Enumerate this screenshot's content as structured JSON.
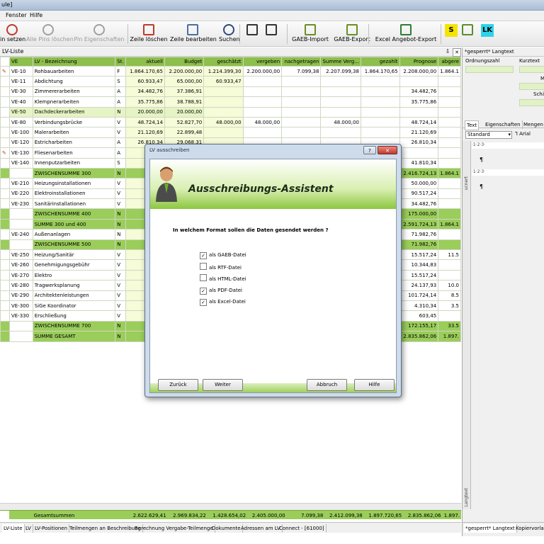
{
  "window": {
    "title_fragment": "ule]"
  },
  "menu": [
    "Fenster",
    "Hilfe"
  ],
  "toolbar": [
    {
      "label": "in setzen",
      "disabled": false,
      "icon": "pin-icon"
    },
    {
      "label": "Alle Pins löschen",
      "disabled": true,
      "icon": "pin-icon"
    },
    {
      "label": "Pin Eigenschaften",
      "disabled": true,
      "icon": "pin-icon"
    },
    {
      "label": "Zeile löschen",
      "disabled": false,
      "icon": "delete-row-icon"
    },
    {
      "label": "Zeile bearbeiten",
      "disabled": false,
      "icon": "edit-row-icon"
    },
    {
      "label": "Suchen",
      "disabled": false,
      "icon": "binoculars-icon"
    },
    {
      "label": "",
      "disabled": false,
      "icon": "indent-icon"
    },
    {
      "label": "",
      "disabled": false,
      "icon": "outdent-icon"
    },
    {
      "label": "GAEB-Import",
      "disabled": false,
      "icon": "gaeb-import-icon"
    },
    {
      "label": "GAEB-Export",
      "disabled": false,
      "icon": "gaeb-export-icon"
    },
    {
      "label": "Excel Angebot-Export",
      "disabled": false,
      "icon": "excel-export-icon"
    },
    {
      "label": "S",
      "disabled": false,
      "icon": "s-icon"
    },
    {
      "label": "",
      "disabled": false,
      "icon": "image-icon"
    },
    {
      "label": "LK",
      "disabled": false,
      "icon": "lk-icon"
    }
  ],
  "lv_panel": {
    "title": "LV-Liste",
    "pin_glyph": "⇩",
    "close_glyph": "✕"
  },
  "columns": [
    "VE",
    "LV - Bezeichnung",
    "St.",
    "aktuell",
    "Budget",
    "geschätzt",
    "vergeben",
    "nachgetragen",
    "Summe Verg...",
    "gezahlt",
    "Prognose",
    "abgere"
  ],
  "rows": [
    {
      "ve": "VE-10",
      "bez": "Rohbauarbeiten",
      "st": "F",
      "aktuell": "1.864.170,65",
      "budget": "2.200.000,00",
      "geschaetzt": "1.214.399,30",
      "vergeben": "2.200.000,00",
      "nach": "7.099,38",
      "summe": "2.207.099,38",
      "gezahlt": "1.864.170,65",
      "prognose": "2.208.000,00",
      "abg": "1.864.1",
      "flag": true
    },
    {
      "ve": "VE-11",
      "bez": "Abdichtung",
      "st": "S",
      "aktuell": "60.933,47",
      "budget": "65.000,00",
      "geschaetzt": "60.933,47",
      "vergeben": "",
      "nach": "",
      "summe": "",
      "gezahlt": "",
      "prognose": "",
      "abg": ""
    },
    {
      "ve": "VE-30",
      "bez": "Zimmererarbeiten",
      "st": "A",
      "aktuell": "34.482,76",
      "budget": "37.386,91",
      "geschaetzt": "",
      "vergeben": "",
      "nach": "",
      "summe": "",
      "gezahlt": "",
      "prognose": "34.482,76",
      "abg": ""
    },
    {
      "ve": "VE-40",
      "bez": "Klempnerarbeiten",
      "st": "A",
      "aktuell": "35.775,86",
      "budget": "38.788,91",
      "geschaetzt": "",
      "vergeben": "",
      "nach": "",
      "summe": "",
      "gezahlt": "",
      "prognose": "35.775,86",
      "abg": ""
    },
    {
      "ve": "VE-50",
      "bez": "Dachdeckerarbeiten",
      "st": "N",
      "aktuell": "20.000,00",
      "budget": "20.000,00",
      "geschaetzt": "",
      "vergeben": "",
      "nach": "",
      "summe": "",
      "gezahlt": "",
      "prognose": "",
      "abg": "",
      "lite": true
    },
    {
      "ve": "VE-80",
      "bez": "Verbindungsbrücke",
      "st": "V",
      "aktuell": "48.724,14",
      "budget": "52.827,70",
      "geschaetzt": "48.000,00",
      "vergeben": "48.000,00",
      "nach": "",
      "summe": "48.000,00",
      "gezahlt": "",
      "prognose": "48.724,14",
      "abg": ""
    },
    {
      "ve": "VE-100",
      "bez": "Malerarbeiten",
      "st": "V",
      "aktuell": "21.120,69",
      "budget": "22.899,48",
      "geschaetzt": "",
      "vergeben": "",
      "nach": "",
      "summe": "",
      "gezahlt": "",
      "prognose": "21.120,69",
      "abg": ""
    },
    {
      "ve": "VE-120",
      "bez": "Estricharbeiten",
      "st": "A",
      "aktuell": "26.810,34",
      "budget": "29.068,31",
      "geschaetzt": "",
      "vergeben": "",
      "nach": "",
      "summe": "",
      "gezahlt": "",
      "prognose": "26.810,34",
      "abg": ""
    },
    {
      "ve": "VE-130",
      "bez": "Fliesenarbeiten",
      "st": "A",
      "aktuell": "",
      "budget": "",
      "geschaetzt": "",
      "vergeben": "",
      "nach": "",
      "summe": "",
      "gezahlt": "",
      "prognose": "",
      "abg": "",
      "flag": true
    },
    {
      "ve": "VE-140",
      "bez": "Innenputzarbeiten",
      "st": "S",
      "aktuell": "",
      "budget": "",
      "geschaetzt": "",
      "vergeben": "",
      "nach": "",
      "summe": "",
      "gezahlt": "",
      "prognose": "41.810,34",
      "abg": ""
    },
    {
      "ve": "",
      "bez": "ZWISCHENSUMME 300",
      "st": "N",
      "aktuell": "",
      "budget": "",
      "geschaetzt": "",
      "vergeben": "",
      "nach": "",
      "summe": "",
      "gezahlt": "",
      "prognose": "2.416.724,13",
      "abg": "1.864.1",
      "sub": true
    },
    {
      "ve": "VE-210",
      "bez": "Heizungsinstallationen",
      "st": "V",
      "aktuell": "",
      "budget": "",
      "geschaetzt": "",
      "vergeben": "",
      "nach": "",
      "summe": "",
      "gezahlt": "",
      "prognose": "50.000,00",
      "abg": ""
    },
    {
      "ve": "VE-220",
      "bez": "Elektroinstallationen",
      "st": "V",
      "aktuell": "",
      "budget": "",
      "geschaetzt": "",
      "vergeben": "",
      "nach": "",
      "summe": "",
      "gezahlt": "",
      "prognose": "90.517,24",
      "abg": ""
    },
    {
      "ve": "VE-230",
      "bez": "Sanitärinstallationen",
      "st": "V",
      "aktuell": "",
      "budget": "",
      "geschaetzt": "",
      "vergeben": "",
      "nach": "",
      "summe": "",
      "gezahlt": "",
      "prognose": "34.482,76",
      "abg": ""
    },
    {
      "ve": "",
      "bez": "ZWISCHENSUMME 400",
      "st": "N",
      "aktuell": "",
      "budget": "",
      "geschaetzt": "",
      "vergeben": "",
      "nach": "",
      "summe": "",
      "gezahlt": "",
      "prognose": "175.000,00",
      "abg": "",
      "sub": true
    },
    {
      "ve": "",
      "bez": "SUMME 300 und 400",
      "st": "N",
      "aktuell": "",
      "budget": "",
      "geschaetzt": "",
      "vergeben": "",
      "nach": "",
      "summe": "",
      "gezahlt": "",
      "prognose": "2.591.724,13",
      "abg": "1.864.1",
      "sub": true
    },
    {
      "ve": "VE-240",
      "bez": "Außenanlagen",
      "st": "N",
      "aktuell": "",
      "budget": "",
      "geschaetzt": "",
      "vergeben": "",
      "nach": "",
      "summe": "",
      "gezahlt": "",
      "prognose": "71.982,76",
      "abg": ""
    },
    {
      "ve": "",
      "bez": "ZWISCHENSUMME 500",
      "st": "N",
      "aktuell": "",
      "budget": "",
      "geschaetzt": "",
      "vergeben": "",
      "nach": "",
      "summe": "",
      "gezahlt": "",
      "prognose": "71.982,76",
      "abg": "",
      "sub": true
    },
    {
      "ve": "VE-250",
      "bez": "Heizung/Sanitär",
      "st": "V",
      "aktuell": "",
      "budget": "",
      "geschaetzt": "",
      "vergeben": "",
      "nach": "",
      "summe": "",
      "gezahlt": "",
      "prognose": "15.517,24",
      "abg": "11.5"
    },
    {
      "ve": "VE-260",
      "bez": "Genehmigungsgebühr",
      "st": "V",
      "aktuell": "",
      "budget": "",
      "geschaetzt": "",
      "vergeben": "",
      "nach": "",
      "summe": "",
      "gezahlt": "",
      "prognose": "10.344,83",
      "abg": ""
    },
    {
      "ve": "VE-270",
      "bez": "Elektro",
      "st": "V",
      "aktuell": "",
      "budget": "",
      "geschaetzt": "",
      "vergeben": "",
      "nach": "",
      "summe": "",
      "gezahlt": "",
      "prognose": "15.517,24",
      "abg": ""
    },
    {
      "ve": "VE-280",
      "bez": "Tragwerksplanung",
      "st": "V",
      "aktuell": "",
      "budget": "",
      "geschaetzt": "",
      "vergeben": "",
      "nach": "",
      "summe": "",
      "gezahlt": "",
      "prognose": "24.137,93",
      "abg": "10.0"
    },
    {
      "ve": "VE-290",
      "bez": "Architektenleistungen",
      "st": "V",
      "aktuell": "",
      "budget": "",
      "geschaetzt": "",
      "vergeben": "",
      "nach": "",
      "summe": "",
      "gezahlt": "",
      "prognose": "101.724,14",
      "abg": "8.5"
    },
    {
      "ve": "VE-300",
      "bez": "SiGe Koordinator",
      "st": "V",
      "aktuell": "",
      "budget": "",
      "geschaetzt": "",
      "vergeben": "",
      "nach": "",
      "summe": "",
      "gezahlt": "",
      "prognose": "4.310,34",
      "abg": "3.5"
    },
    {
      "ve": "VE-330",
      "bez": "Erschließung",
      "st": "V",
      "aktuell": "",
      "budget": "",
      "geschaetzt": "",
      "vergeben": "",
      "nach": "",
      "summe": "",
      "gezahlt": "",
      "prognose": "603,45",
      "abg": ""
    },
    {
      "ve": "",
      "bez": "ZWISCHENSUMME 700",
      "st": "N",
      "aktuell": "",
      "budget": "",
      "geschaetzt": "",
      "vergeben": "",
      "nach": "",
      "summe": "",
      "gezahlt": "",
      "prognose": "172.155,17",
      "abg": "33.5",
      "sub": true
    },
    {
      "ve": "",
      "bez": "SUMME GESAMT",
      "st": "N",
      "aktuell": "",
      "budget": "",
      "geschaetzt": "",
      "vergeben": "",
      "nach": "",
      "summe": "",
      "gezahlt": "",
      "prognose": "2.835.862,06",
      "abg": "1.897.",
      "sub": true
    }
  ],
  "totals": {
    "label": "Gesamtsummen",
    "aktuell": "2.622.629,41",
    "budget": "2.969.834,22",
    "geschaetzt": "1.428.654,02",
    "vergeben": "2.405.000,00",
    "nach": "7.099,38",
    "summe": "2.412.099,38",
    "gezahlt": "1.897.720,65",
    "prognose": "2.835.862,06",
    "abg": "1.897."
  },
  "bottom_tabs": [
    "LV-Liste",
    "LV",
    "LV-Positionen",
    "Teilmengen an Beschreibung",
    "Berechnung Vergabe-Teilmenge",
    "Dokumente",
    "Adressen am LV",
    "Connect - [61000]"
  ],
  "right_panel": {
    "title": "*gesperrt* Langtext",
    "field1": "Ordnungszahl",
    "field2": "Kurztext",
    "field3": "M",
    "field4": "Schä",
    "tabs": [
      "Text",
      "Eigenschaften",
      "Mengen e"
    ],
    "style_value": "Standard",
    "font_value": "Arial",
    "ruler": "·1·2·3·",
    "side_label": "Langtext",
    "side_label2": "ucnert",
    "pilcrow": "¶",
    "bottom_tabs": [
      "*gesperrt* Langtext",
      "Kopiervorlag"
    ]
  },
  "dialog": {
    "title": "LV ausschreiben",
    "help_glyph": "?",
    "close_glyph": "✕",
    "banner_title": "Ausschreibungs-Assistent",
    "question": "In welchem Format sollen die Daten gesendet werden ?",
    "options": [
      {
        "label": "als GAEB-Datei",
        "checked": true
      },
      {
        "label": "als RTF-Datei",
        "checked": false
      },
      {
        "label": "als HTML-Datei",
        "checked": false
      },
      {
        "label": "als PDF-Datei",
        "checked": true
      },
      {
        "label": "als Excel-Datei",
        "checked": true
      }
    ],
    "buttons": {
      "back": "Zurück",
      "next": "Weiter",
      "cancel": "Abbruch",
      "help": "Hilfe"
    }
  },
  "colors": {
    "accent_green": "#8cbf4c",
    "sub_green": "#9acd5a",
    "light_yellow": "#f6fbd8"
  }
}
